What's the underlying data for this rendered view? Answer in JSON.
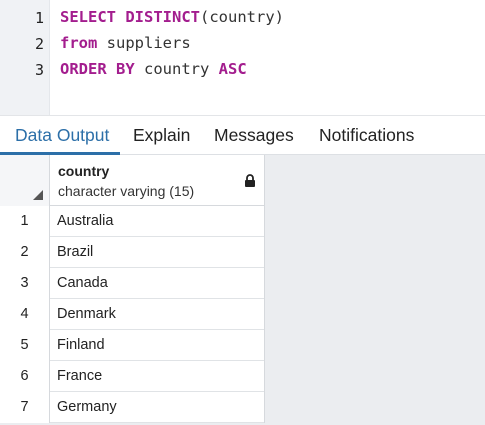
{
  "editor": {
    "lines": [
      {
        "number": "1",
        "tokens": [
          {
            "text": "SELECT",
            "kind": "kw"
          },
          {
            "text": " ",
            "kind": "plain"
          },
          {
            "text": "DISTINCT",
            "kind": "kw"
          },
          {
            "text": "(country)",
            "kind": "plain"
          }
        ]
      },
      {
        "number": "2",
        "tokens": [
          {
            "text": "from",
            "kind": "kw"
          },
          {
            "text": " suppliers",
            "kind": "plain"
          }
        ]
      },
      {
        "number": "3",
        "tokens": [
          {
            "text": "ORDER BY",
            "kind": "kw"
          },
          {
            "text": " country ",
            "kind": "plain"
          },
          {
            "text": "ASC",
            "kind": "kw"
          }
        ]
      }
    ]
  },
  "tabs": [
    {
      "label": "Data Output",
      "active": true
    },
    {
      "label": "Explain",
      "active": false
    },
    {
      "label": "Messages",
      "active": false
    },
    {
      "label": "Notifications",
      "active": false
    }
  ],
  "grid": {
    "column": {
      "name": "country",
      "type": "character varying (15)",
      "icon": "lock-icon"
    },
    "rows": [
      {
        "num": "1",
        "value": "Australia"
      },
      {
        "num": "2",
        "value": "Brazil"
      },
      {
        "num": "3",
        "value": "Canada"
      },
      {
        "num": "4",
        "value": "Denmark"
      },
      {
        "num": "5",
        "value": "Finland"
      },
      {
        "num": "6",
        "value": "France"
      },
      {
        "num": "7",
        "value": "Germany"
      }
    ]
  },
  "colors": {
    "keyword": "#a31d8e",
    "active_tab": "#2c6fa8",
    "gutter_bg": "#f0f2f5",
    "grid_empty_bg": "#ebedf0"
  }
}
